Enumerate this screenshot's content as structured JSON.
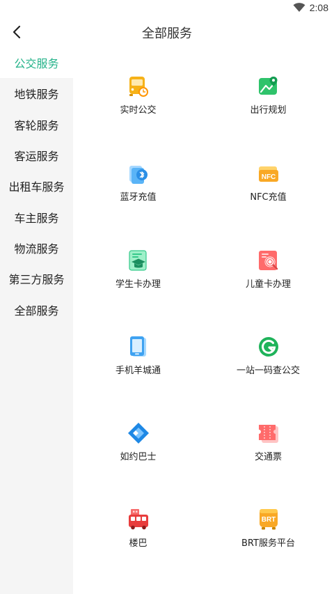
{
  "status": {
    "time": "2:08"
  },
  "header": {
    "title": "全部服务"
  },
  "sidebar": {
    "items": [
      {
        "label": "公交服务",
        "active": true
      },
      {
        "label": "地铁服务"
      },
      {
        "label": "客轮服务"
      },
      {
        "label": "客运服务"
      },
      {
        "label": "出租车服务"
      },
      {
        "label": "车主服务"
      },
      {
        "label": "物流服务"
      },
      {
        "label": "第三方服务"
      },
      {
        "label": "全部服务"
      }
    ]
  },
  "services": [
    {
      "label": "实时公交",
      "icon": "bus-clock-icon"
    },
    {
      "label": "出行规划",
      "icon": "map-route-icon"
    },
    {
      "label": "蓝牙充值",
      "icon": "bluetooth-card-icon"
    },
    {
      "label": "NFC充值",
      "icon": "nfc-card-icon"
    },
    {
      "label": "学生卡办理",
      "icon": "student-card-icon"
    },
    {
      "label": "儿童卡办理",
      "icon": "child-card-icon"
    },
    {
      "label": "手机羊城通",
      "icon": "mobile-phone-icon"
    },
    {
      "label": "一站一码查公交",
      "icon": "g-circle-icon"
    },
    {
      "label": "如约巴士",
      "icon": "ruyue-bus-icon"
    },
    {
      "label": "交通票",
      "icon": "ticket-icon"
    },
    {
      "label": "楼巴",
      "icon": "building-bus-icon"
    },
    {
      "label": "BRT服务平台",
      "icon": "brt-bus-icon"
    }
  ],
  "brt_badge": "BRT",
  "nfc_badge": "NFC",
  "colors": {
    "accent": "#25b38a",
    "sidebar_bg": "#f5f5f5"
  }
}
